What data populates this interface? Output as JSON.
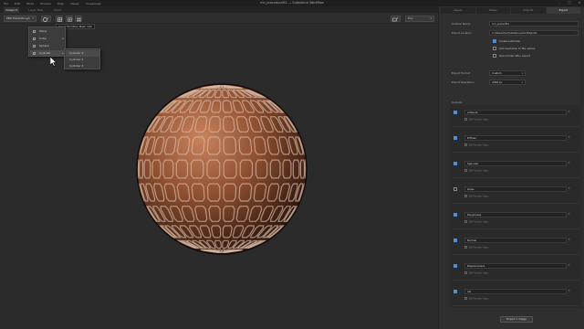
{
  "window": {
    "title": "mn_proceduralS1 — Substance Workflow"
  },
  "menubar": [
    "File",
    "Edit",
    "Mode",
    "Window",
    "Help",
    "Viewer",
    "Screencast"
  ],
  "left_tabs": [
    "Viewport",
    "Layer Tabs",
    "Shelf"
  ],
  "viewer_toolbar": {
    "display_select": "PBR Metal/Rough",
    "tooltip": "Select Primitive Mesh (Alt)",
    "right_select": "Env"
  },
  "shape_menu": {
    "items": [
      "Plane",
      "Cube",
      "Sphere",
      "Cylinder"
    ],
    "highlighted": "Cylinder",
    "submenu": [
      "Cylinder 1",
      "Cylinder 2",
      "Cylinder 3"
    ]
  },
  "right_tabs": [
    "Layers",
    "Shape",
    "Outputs",
    "Export"
  ],
  "export": {
    "output_name_label": "Outliner Name",
    "output_name_value": "mn_procedS1",
    "export_location_label": "Export Location",
    "export_location_value": "C:/Users/mn/Substance/mn/Exports",
    "options": [
      {
        "label": "Create subfolder",
        "checked": true
      },
      {
        "label": "Add resolution to file names",
        "checked": false
      },
      {
        "label": "Open folder after export",
        "checked": false
      }
    ],
    "format_label": "Export Format",
    "format_value": "Custom",
    "resolution_label": "Export Resolution",
    "resolution_value": "2048 px"
  },
  "outputs_header": "Outputs",
  "outputs": [
    {
      "name": "ambient",
      "checked": true,
      "sub": "Bit Format: 8bpc"
    },
    {
      "name": "Diffuse",
      "checked": true,
      "sub": "Bit Format: 8bpc"
    },
    {
      "name": "Specular",
      "checked": true,
      "sub": "Bit Format: 8bpc"
    },
    {
      "name": "Gloss",
      "checked": false,
      "sub": "Bit Format: 8bpc"
    },
    {
      "name": "Roughness",
      "checked": true,
      "sub": "Bit Format: 8bpc"
    },
    {
      "name": "Normal",
      "checked": true,
      "sub": "Bit Format: 8bpc"
    },
    {
      "name": "Displacement",
      "checked": true,
      "sub": "Bit Format: 8bpc"
    },
    {
      "name": "AO",
      "checked": true,
      "sub": "Bit Format: 8bpc"
    }
  ],
  "export_button": "Export 1 image",
  "colors": {
    "accent": "#4a90d9",
    "panel": "#2f2f2f",
    "viewport": "#2b2b2b"
  },
  "icons": [
    "minimize-icon",
    "maximize-icon",
    "close-icon",
    "sphere-icon",
    "grid-icon",
    "cube-icon",
    "mouse-cursor-icon"
  ]
}
